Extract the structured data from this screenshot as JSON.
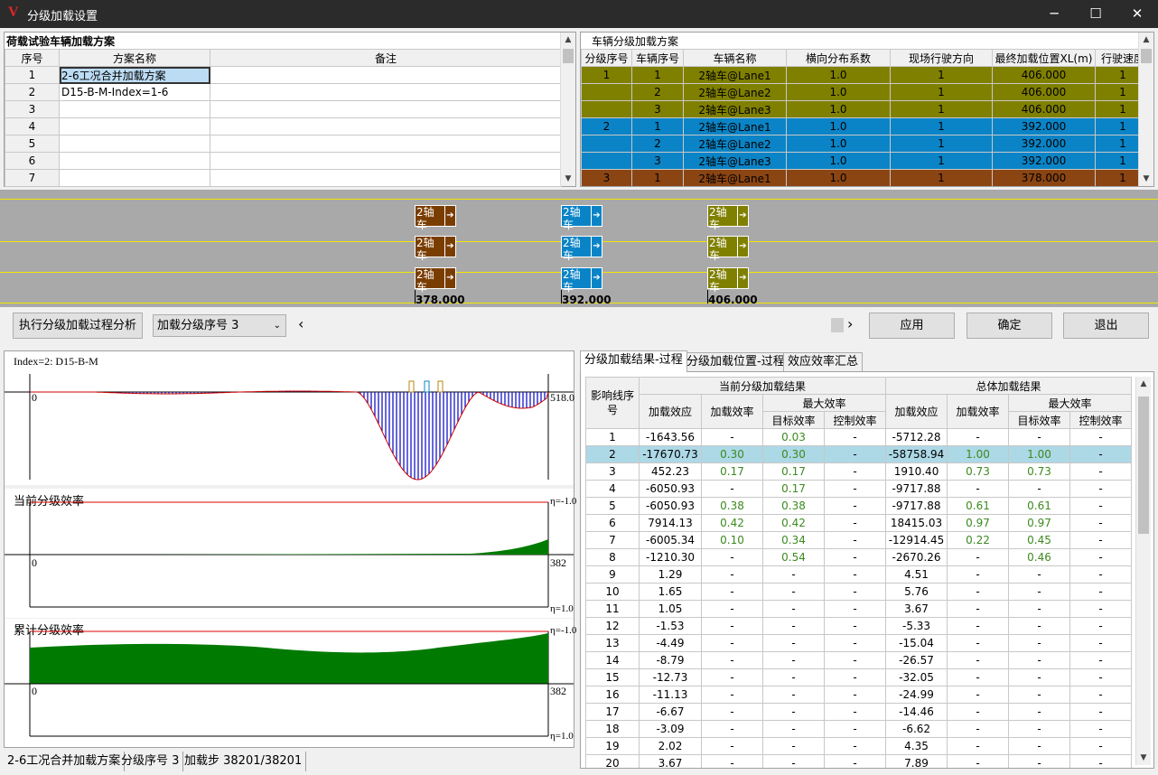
{
  "window": {
    "title": "分级加载设置",
    "logo": "V",
    "min": "─",
    "max": "☐",
    "close": "✕"
  },
  "scheme_panel": {
    "title": "荷载试验车辆加载方案",
    "headers": [
      "序号",
      "方案名称",
      "备注"
    ],
    "rows": [
      [
        "1",
        "2-6工况合并加载方案",
        ""
      ],
      [
        "2",
        "D15-B-M-Index=1-6",
        ""
      ],
      [
        "3",
        "",
        ""
      ],
      [
        "4",
        "",
        ""
      ],
      [
        "5",
        "",
        ""
      ],
      [
        "6",
        "",
        ""
      ],
      [
        "7",
        "",
        ""
      ]
    ]
  },
  "vehicle_panel": {
    "title": "车辆分级加载方案",
    "headers": [
      "分级序号",
      "车辆序号",
      "车辆名称",
      "横向分布系数",
      "现场行驶方向",
      "最终加载位置XL(m)",
      "行驶速度"
    ],
    "rows": [
      {
        "c": [
          "1",
          "1",
          "2轴车@Lane1",
          "1.0",
          "1",
          "406.000",
          "1"
        ],
        "color": "#808000"
      },
      {
        "c": [
          "",
          "2",
          "2轴车@Lane2",
          "1.0",
          "1",
          "406.000",
          "1"
        ],
        "color": "#808000"
      },
      {
        "c": [
          "",
          "3",
          "2轴车@Lane3",
          "1.0",
          "1",
          "406.000",
          "1"
        ],
        "color": "#808000"
      },
      {
        "c": [
          "2",
          "1",
          "2轴车@Lane1",
          "1.0",
          "1",
          "392.000",
          "1"
        ],
        "color": "#0a84c6"
      },
      {
        "c": [
          "",
          "2",
          "2轴车@Lane2",
          "1.0",
          "1",
          "392.000",
          "1"
        ],
        "color": "#0a84c6"
      },
      {
        "c": [
          "",
          "3",
          "2轴车@Lane3",
          "1.0",
          "1",
          "392.000",
          "1"
        ],
        "color": "#0a84c6"
      },
      {
        "c": [
          "3",
          "1",
          "2轴车@Lane1",
          "1.0",
          "1",
          "378.000",
          "1"
        ],
        "color": "#8b4513"
      }
    ]
  },
  "lanes": {
    "vehicle_label": "2轴车",
    "arrow": "➔",
    "groups": [
      {
        "pos": "378.000",
        "color": "#7a3d00"
      },
      {
        "pos": "392.000",
        "color": "#0a84c6"
      },
      {
        "pos": "406.000",
        "color": "#808000"
      }
    ]
  },
  "controls": {
    "analyze": "执行分级加载过程分析",
    "select_value": "加载分级序号 3",
    "apply": "应用",
    "ok": "确定",
    "exit": "退出",
    "left_arrow": "‹",
    "right_arrow": "›"
  },
  "plots": {
    "index_label": "Index=2: D15-B-M",
    "zero": "0",
    "right_top": "518.0",
    "current_title": "当前分级效率",
    "cumulative_title": "累计分级效率",
    "eta_top": "η=-1.0",
    "eta_bottom": "η=1.0",
    "right_mid": "382"
  },
  "tabs": [
    "分级加载结果-过程",
    "分级加载位置-过程",
    "效应效率汇总"
  ],
  "results": {
    "h_infl": "影响线序号",
    "h_current": "当前分级加载结果",
    "h_total": "总体加载结果",
    "h_effect": "加载效应",
    "h_eff": "加载效率",
    "h_max": "最大效率",
    "h_target": "目标效率",
    "h_control": "控制效率",
    "rows": [
      [
        "1",
        "-1643.56",
        "-",
        "0.03",
        "-",
        "-5712.28",
        "-",
        "-",
        "-"
      ],
      [
        "2",
        "-17670.73",
        "0.30",
        "0.30",
        "-",
        "-58758.94",
        "1.00",
        "1.00",
        "-"
      ],
      [
        "3",
        "452.23",
        "0.17",
        "0.17",
        "-",
        "1910.40",
        "0.73",
        "0.73",
        "-"
      ],
      [
        "4",
        "-6050.93",
        "-",
        "0.17",
        "-",
        "-9717.88",
        "-",
        "-",
        "-"
      ],
      [
        "5",
        "-6050.93",
        "0.38",
        "0.38",
        "-",
        "-9717.88",
        "0.61",
        "0.61",
        "-"
      ],
      [
        "6",
        "7914.13",
        "0.42",
        "0.42",
        "-",
        "18415.03",
        "0.97",
        "0.97",
        "-"
      ],
      [
        "7",
        "-6005.34",
        "0.10",
        "0.34",
        "-",
        "-12914.45",
        "0.22",
        "0.45",
        "-"
      ],
      [
        "8",
        "-1210.30",
        "-",
        "0.54",
        "-",
        "-2670.26",
        "-",
        "0.46",
        "-"
      ],
      [
        "9",
        "1.29",
        "-",
        "-",
        "-",
        "4.51",
        "-",
        "-",
        "-"
      ],
      [
        "10",
        "1.65",
        "-",
        "-",
        "-",
        "5.76",
        "-",
        "-",
        "-"
      ],
      [
        "11",
        "1.05",
        "-",
        "-",
        "-",
        "3.67",
        "-",
        "-",
        "-"
      ],
      [
        "12",
        "-1.53",
        "-",
        "-",
        "-",
        "-5.33",
        "-",
        "-",
        "-"
      ],
      [
        "13",
        "-4.49",
        "-",
        "-",
        "-",
        "-15.04",
        "-",
        "-",
        "-"
      ],
      [
        "14",
        "-8.79",
        "-",
        "-",
        "-",
        "-26.57",
        "-",
        "-",
        "-"
      ],
      [
        "15",
        "-12.73",
        "-",
        "-",
        "-",
        "-32.05",
        "-",
        "-",
        "-"
      ],
      [
        "16",
        "-11.13",
        "-",
        "-",
        "-",
        "-24.99",
        "-",
        "-",
        "-"
      ],
      [
        "17",
        "-6.67",
        "-",
        "-",
        "-",
        "-14.46",
        "-",
        "-",
        "-"
      ],
      [
        "18",
        "-3.09",
        "-",
        "-",
        "-",
        "-6.62",
        "-",
        "-",
        "-"
      ],
      [
        "19",
        "2.02",
        "-",
        "-",
        "-",
        "4.35",
        "-",
        "-",
        "-"
      ],
      [
        "20",
        "3.67",
        "-",
        "-",
        "-",
        "7.89",
        "-",
        "-",
        "-"
      ]
    ]
  },
  "status": [
    "2-6工况合并加载方案",
    "分级序号 3",
    "加载步 38201/38201"
  ]
}
